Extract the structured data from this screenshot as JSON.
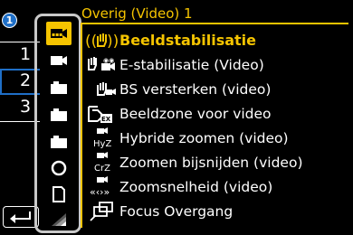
{
  "step": "1",
  "title": "Overig (Video) 1",
  "tabs": [
    "1",
    "2",
    "3"
  ],
  "icon_column": [
    {
      "icon": "video-menu-icon",
      "selected": true
    },
    {
      "icon": "video-camera-icon"
    },
    {
      "icon": "camera-icon"
    },
    {
      "icon": "camera-icon"
    },
    {
      "icon": "camera-icon"
    },
    {
      "icon": "circle-icon"
    },
    {
      "icon": "card-icon"
    },
    {
      "icon": "wifi-icon"
    }
  ],
  "menu": {
    "items": [
      {
        "label": "Beeldstabilisatie",
        "icon": "hand-shake-icon",
        "selected": true
      },
      {
        "label": "E-stabilisatie (Video)",
        "icon": "e-stabilization-icon"
      },
      {
        "label": "BS versterken (video)",
        "icon": "boost-is-icon"
      },
      {
        "label": "Beeldzone voor video",
        "icon": "ex-zone-icon"
      },
      {
        "label": "Hybride zoomen (video)",
        "icon": "hybrid-zoom-icon"
      },
      {
        "label": "Zoomen bijsnijden (video)",
        "icon": "crop-zoom-icon"
      },
      {
        "label": "Zoomsnelheid (video)",
        "icon": "zoom-speed-icon"
      },
      {
        "label": "Focus Overgang",
        "icon": "focus-transition-icon"
      }
    ]
  },
  "colors": {
    "accent": "#f5c400",
    "blue": "#1f6fc7",
    "frame": "#c9c9c9"
  }
}
